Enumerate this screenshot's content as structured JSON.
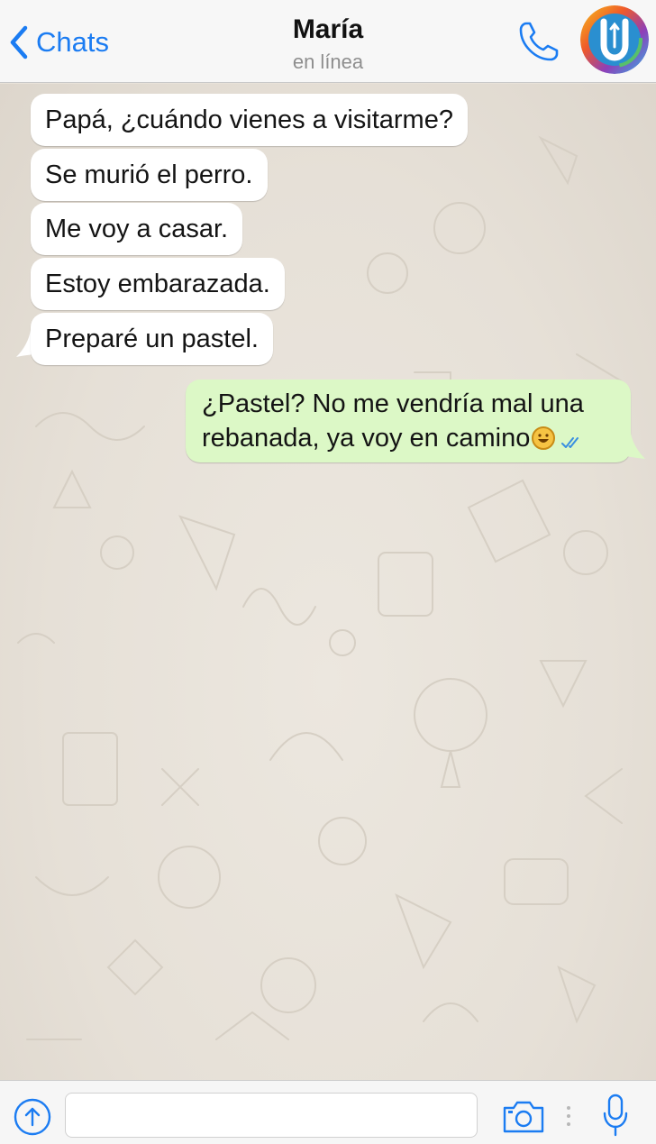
{
  "header": {
    "back_label": "Chats",
    "contact_name": "María",
    "contact_status": "en línea"
  },
  "messages": [
    {
      "direction": "in",
      "text": "Papá, ¿cuándo vienes a visitarme?"
    },
    {
      "direction": "in",
      "text": "Se murió el perro."
    },
    {
      "direction": "in",
      "text": "Me voy a casar."
    },
    {
      "direction": "in",
      "text": "Estoy embarazada."
    },
    {
      "direction": "in",
      "text": "Preparé un pastel."
    },
    {
      "direction": "out",
      "line1": "¿Pastel? No me vendría mal una",
      "line2": "rebanada, ya voy en camino",
      "emoji": "grinning-face-emoji",
      "status": "read-double-check"
    }
  ],
  "input": {
    "placeholder": "",
    "value": ""
  },
  "colors": {
    "accent": "#1b7cf2",
    "incoming_bubble": "#ffffff",
    "outgoing_bubble": "#dcf8c6",
    "chat_background": "#e8e2d9",
    "read_ticks": "#3a8fe0"
  },
  "icons": {
    "back": "chevron-left-icon",
    "call": "phone-icon",
    "avatar": "u-logo-avatar",
    "share": "arrow-up-circle-icon",
    "camera": "camera-icon",
    "mic": "microphone-icon"
  }
}
